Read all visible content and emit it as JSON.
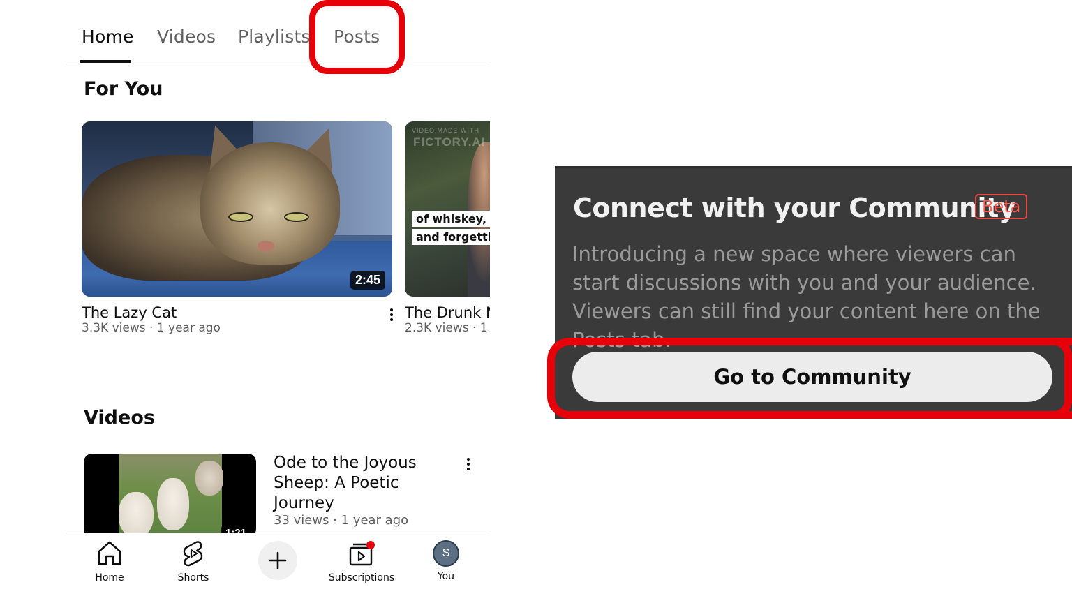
{
  "tabs": [
    {
      "label": "Home",
      "active": true
    },
    {
      "label": "Videos",
      "active": false
    },
    {
      "label": "Playlists",
      "active": false
    },
    {
      "label": "Posts",
      "active": false,
      "highlighted": true
    }
  ],
  "for_you": {
    "title": "For You",
    "cards": [
      {
        "title": "The Lazy Cat",
        "meta": "3.3K views · 1 year ago",
        "duration": "2:45"
      },
      {
        "title": "The Drunk M",
        "meta": "2.3K views · 1",
        "watermark": "VIDEO MADE WITH",
        "watermark2": "FICTORY.AI",
        "caption_line1": "of whiskey, c",
        "caption_line2": "and forgetti"
      }
    ]
  },
  "videos": {
    "title": "Videos",
    "items": [
      {
        "title": "Ode to the Joyous Sheep: A Poetic Journey",
        "meta": "33 views · 1 year ago",
        "duration": "1:21"
      }
    ]
  },
  "bottom_nav": {
    "home": "Home",
    "shorts": "Shorts",
    "subscriptions": "Subscriptions",
    "you": "You",
    "avatar_initial": "S",
    "subscriptions_badge_color": "#e5000a"
  },
  "community": {
    "title": "Connect with your Community",
    "badge": "Beta",
    "description": "Introducing a new space where viewers can start discussions with you and your audience. Viewers can still find your content here on the Posts tab.",
    "button": "Go to Community"
  },
  "colors": {
    "highlight": "#e5000a",
    "community_bg": "#3a3a3a",
    "beta": "#ff5a4e"
  }
}
